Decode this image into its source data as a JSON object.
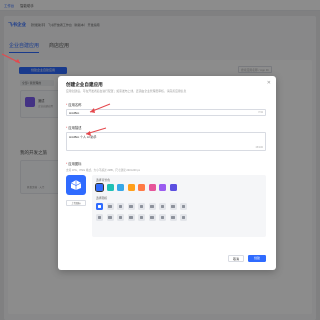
{
  "topbar": {
    "nav": [
      "工作台",
      "智能助手"
    ]
  },
  "header": {
    "brand": "飞书",
    "brand_suffix": "企业",
    "crumb": "【智能助手】 飞书开放者工作台（新版本） 开发指南"
  },
  "tabs": [
    {
      "label": "企业自建应用"
    },
    {
      "label": "商店应用"
    }
  ],
  "background": {
    "create_button": "创建企业自建应用",
    "filter_label": "全部 / 我管理的",
    "search_placeholder": "搜索应用名称 / App ID",
    "app_name": "测试",
    "app_desc": "企业自建应用",
    "section_title": "我的开发之旅",
    "agent_text": "开发文档 · 入门"
  },
  "modal": {
    "title": "创建企业自建应用",
    "subtitle": "应用创建后，可在开发者后台进行配置；如需发布上线，还需由企业管理员审核，请完善应用信息",
    "name_label": "应用名称",
    "name_value": "HiAIBot",
    "name_counter": "7/32",
    "desc_label": "应用描述",
    "desc_value": "HiAIBot 个人 AI 助手",
    "desc_counter": "15/100",
    "icon_label": "应用图标",
    "icon_hint": "支持 JPG、PNG 格式，大小不超过 2MB，尺寸建议 240×240 px",
    "upload_label": "上传图标",
    "color_label": "选择背景色",
    "glyph_label": "选择图标",
    "cancel_label": "取消",
    "create_label": "创建"
  },
  "colors": {
    "accent": "#2f6bff",
    "swatches": [
      "#2f6bff",
      "#1fc0b4",
      "#36a7e8",
      "#ff9f1a",
      "#ff7a45",
      "#e6559a",
      "#9a5cf0",
      "#5b4fe0"
    ],
    "selected_swatch_index": 0,
    "annotation": "#e5484d"
  },
  "icons": {
    "close": "close-icon",
    "preview": "robot-icon",
    "selected_glyph_index": 0,
    "glyphs": [
      "robot-icon",
      "chat-icon",
      "folder-icon",
      "doc-icon",
      "calendar-icon",
      "mail-icon",
      "star-icon",
      "bell-icon",
      "user-icon",
      "chart-icon",
      "cart-icon",
      "phone-icon",
      "clock-icon",
      "cloud-icon",
      "heart-icon",
      "gear-icon",
      "flag-icon",
      "key-icon"
    ]
  }
}
